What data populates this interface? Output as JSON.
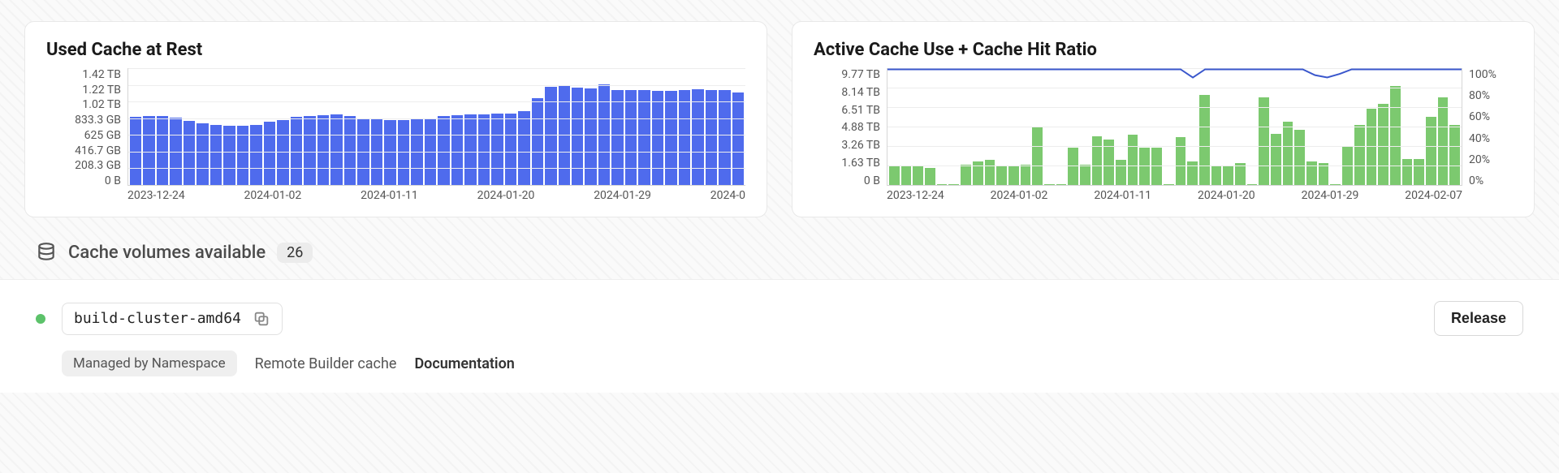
{
  "chart1": {
    "title": "Used Cache at Rest",
    "y_ticks": [
      "1.42 TB",
      "1.22 TB",
      "1.02 TB",
      "833.3 GB",
      "625 GB",
      "416.7 GB",
      "208.3 GB",
      "0 B"
    ],
    "x_ticks": [
      "2023-12-24",
      "2024-01-02",
      "2024-01-11",
      "2024-01-20",
      "2024-01-29",
      "2024-0"
    ]
  },
  "chart2": {
    "title": "Active Cache Use + Cache Hit Ratio",
    "y_ticks_left": [
      "9.77 TB",
      "8.14 TB",
      "6.51 TB",
      "4.88 TB",
      "3.26 TB",
      "1.63 TB",
      "0 B"
    ],
    "y_ticks_right": [
      "100%",
      "80%",
      "60%",
      "40%",
      "20%",
      "0%"
    ],
    "x_ticks": [
      "2023-12-24",
      "2024-01-02",
      "2024-01-11",
      "2024-01-20",
      "2024-01-29",
      "2024-02-07"
    ]
  },
  "section": {
    "title": "Cache volumes available",
    "count": "26"
  },
  "volume": {
    "cluster_name": "build-cluster-amd64",
    "release_label": "Release",
    "managed_label": "Managed by Namespace",
    "remote_label": "Remote Builder cache",
    "doc_label": "Documentation"
  },
  "chart_data": [
    {
      "type": "bar",
      "title": "Used Cache at Rest",
      "xlabel": "",
      "ylabel": "",
      "ylim_gb": [
        0,
        1420
      ],
      "categories_range": "2023-12-24 .. 2024-02-07 (daily)",
      "values_gb": [
        830,
        840,
        835,
        820,
        780,
        750,
        730,
        720,
        720,
        730,
        770,
        790,
        830,
        840,
        850,
        860,
        840,
        810,
        800,
        790,
        790,
        800,
        810,
        840,
        850,
        860,
        860,
        870,
        870,
        900,
        1060,
        1190,
        1200,
        1180,
        1170,
        1220,
        1150,
        1150,
        1150,
        1140,
        1140,
        1150,
        1160,
        1150,
        1150,
        1120
      ],
      "y_ticks": [
        "0 B",
        "208.3 GB",
        "416.7 GB",
        "625 GB",
        "833.3 GB",
        "1.02 TB",
        "1.22 TB",
        "1.42 TB"
      ]
    },
    {
      "type": "bar+line",
      "title": "Active Cache Use + Cache Hit Ratio",
      "xlabel": "",
      "left_ylabel": "",
      "right_ylabel": "",
      "left_ylim_tb": [
        0,
        9.77
      ],
      "right_ylim_pct": [
        0,
        100
      ],
      "categories_range": "2023-12-24 .. 2024-02-07 (daily)",
      "bars_active_cache_tb": [
        1.6,
        1.6,
        1.6,
        1.4,
        0.1,
        0.1,
        1.7,
        2.0,
        2.1,
        1.6,
        1.6,
        1.7,
        4.9,
        0.1,
        0.1,
        3.1,
        1.7,
        4.1,
        3.8,
        2.1,
        4.2,
        3.1,
        3.1,
        0.1,
        4.0,
        2.0,
        7.5,
        1.6,
        1.6,
        1.8,
        0.1,
        7.3,
        4.3,
        5.3,
        4.6,
        2.0,
        1.8,
        0.1,
        3.2,
        5.0,
        6.4,
        6.8,
        8.3,
        2.2,
        2.2,
        5.7,
        7.3,
        5.0
      ],
      "line_hit_ratio_pct": [
        99,
        99,
        99,
        99,
        99,
        99,
        99,
        99,
        99,
        99,
        99,
        99,
        99,
        99,
        99,
        99,
        99,
        99,
        99,
        99,
        99,
        99,
        99,
        99,
        99,
        92,
        99,
        99,
        99,
        99,
        99,
        99,
        99,
        99,
        99,
        94,
        92,
        95,
        99,
        99,
        99,
        99,
        99,
        99,
        99,
        99,
        99,
        99
      ],
      "y_ticks_left": [
        "0 B",
        "1.63 TB",
        "3.26 TB",
        "4.88 TB",
        "6.51 TB",
        "8.14 TB",
        "9.77 TB"
      ],
      "y_ticks_right": [
        "0%",
        "20%",
        "40%",
        "60%",
        "80%",
        "100%"
      ]
    }
  ]
}
